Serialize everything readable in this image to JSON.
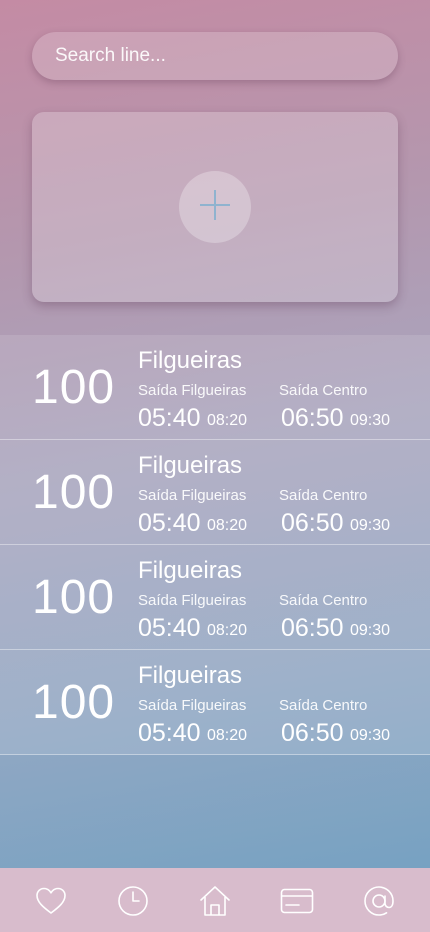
{
  "search": {
    "placeholder": "Search line..."
  },
  "add_card": {
    "icon": "plus-icon"
  },
  "lines": [
    {
      "number": "100",
      "name": "Filgueiras",
      "departures": [
        {
          "label": "Saída Filgueiras",
          "time": "05:40",
          "next": "08:20"
        },
        {
          "label": "Saída Centro",
          "time": "06:50",
          "next": "09:30"
        }
      ]
    },
    {
      "number": "100",
      "name": "Filgueiras",
      "departures": [
        {
          "label": "Saída Filgueiras",
          "time": "05:40",
          "next": "08:20"
        },
        {
          "label": "Saída Centro",
          "time": "06:50",
          "next": "09:30"
        }
      ]
    },
    {
      "number": "100",
      "name": "Filgueiras",
      "departures": [
        {
          "label": "Saída Filgueiras",
          "time": "05:40",
          "next": "08:20"
        },
        {
          "label": "Saída Centro",
          "time": "06:50",
          "next": "09:30"
        }
      ]
    },
    {
      "number": "100",
      "name": "Filgueiras",
      "departures": [
        {
          "label": "Saída Filgueiras",
          "time": "05:40",
          "next": "08:20"
        },
        {
          "label": "Saída Centro",
          "time": "06:50",
          "next": "09:30"
        }
      ]
    }
  ],
  "tabbar": {
    "items": [
      {
        "icon": "heart-icon"
      },
      {
        "icon": "clock-icon"
      },
      {
        "icon": "home-icon"
      },
      {
        "icon": "credit-card-icon"
      },
      {
        "icon": "at-icon"
      }
    ]
  },
  "colors": {
    "text": "#ffffff",
    "tabbar_bg": "#d8bccc",
    "plus_icon": "#8fb3cf",
    "gradient_top": "#c48ba4",
    "gradient_bottom": "#6fa0c2"
  }
}
